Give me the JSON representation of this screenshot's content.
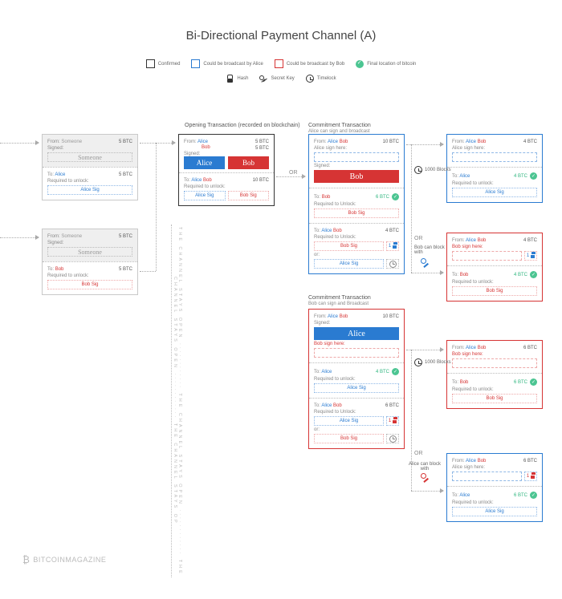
{
  "title": "Bi-Directional Payment Channel (A)",
  "legend": {
    "confirmed": "Confirmed",
    "broadcast_alice": "Could be broadcast by Alice",
    "broadcast_bob": "Could be broadcast by Bob",
    "final": "Final location of bitcoin",
    "hash": "Hash",
    "secret": "Secret Key",
    "timelock": "Timelock"
  },
  "labels": {
    "from": "From:",
    "to": "To:",
    "signed": "Signed:",
    "required": "Required to unlock:",
    "required2": "Required to Unlock:",
    "or": "or:",
    "someone": "Someone",
    "alice": "Alice",
    "bob": "Bob",
    "alice_sig": "Alice Sig",
    "bob_sig": "Bob Sig",
    "alice_sign_here": "Alice sign here:",
    "bob_sign_here": "Bob sign here:",
    "one": "1"
  },
  "amounts": {
    "five": "5 BTC",
    "ten": "10 BTC",
    "four": "4 BTC",
    "six": "6 BTC"
  },
  "sections": {
    "opening": "Opening Transaction (recorded on blockchain)",
    "commit": "Commitment Transaction",
    "alice_can": "Alice can sign and broadcast",
    "bob_can": "Bob can sign and Broadcast"
  },
  "connectors": {
    "or": "OR",
    "blocks": "1000 Blocks",
    "bob_block": "Bob can block with",
    "alice_block": "Alice can block with"
  },
  "vertical": "THE CHANNEL STAYS OPEN ············ THE CHANNEL STAYS OPEN ············ THE CHANNEL STAYS OPEN ············ THE CHANNEL STAYS OP",
  "brand": "BITCOINMAGAZINE"
}
